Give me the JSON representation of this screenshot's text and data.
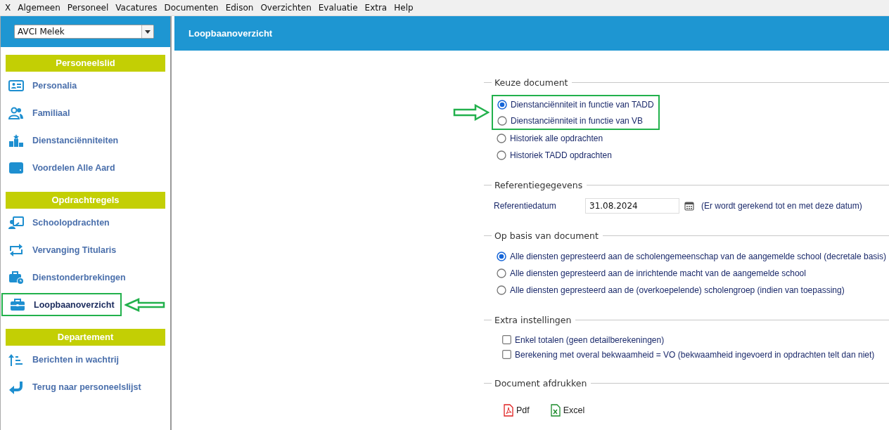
{
  "menu_bar": {
    "items": [
      "X",
      "Algemeen",
      "Personeel",
      "Vacatures",
      "Documenten",
      "Edison",
      "Overzichten",
      "Evaluatie",
      "Extra",
      "Help"
    ]
  },
  "sidebar": {
    "person_select": {
      "value": "AVCI Melek"
    },
    "groups": [
      {
        "title": "Personeelslid",
        "items": [
          {
            "label": "Personalia",
            "selected": false,
            "highlighted": false
          },
          {
            "label": "Familiaal",
            "selected": false,
            "highlighted": false
          },
          {
            "label": "Dienstanciënniteiten",
            "selected": false,
            "highlighted": false
          },
          {
            "label": "Voordelen Alle Aard",
            "selected": false,
            "highlighted": false
          }
        ]
      },
      {
        "title": "Opdrachtregels",
        "items": [
          {
            "label": "Schoolopdrachten",
            "selected": false,
            "highlighted": false
          },
          {
            "label": "Vervanging Titularis",
            "selected": false,
            "highlighted": false
          },
          {
            "label": "Dienstonderbrekingen",
            "selected": false,
            "highlighted": false
          },
          {
            "label": "Loopbaanoverzicht",
            "selected": true,
            "highlighted": true
          }
        ]
      },
      {
        "title": "Departement",
        "items": [
          {
            "label": "Berichten in wachtrij",
            "selected": false,
            "highlighted": false
          },
          {
            "label": "Terug naar personeelslijst",
            "selected": false,
            "highlighted": false
          }
        ]
      }
    ]
  },
  "header": {
    "title": "Loopbaanoverzicht"
  },
  "sections": [
    {
      "kind": "radios",
      "title": "Keuze document",
      "options": [
        {
          "label": "Dienstanciënniteit in functie van TADD",
          "selected": true,
          "highlighted": true
        },
        {
          "label": "Dienstanciënniteit in functie van VB",
          "selected": false,
          "highlighted": true
        },
        {
          "label": "Historiek alle opdrachten",
          "selected": false,
          "highlighted": false
        },
        {
          "label": "Historiek TADD opdrachten",
          "selected": false,
          "highlighted": false
        }
      ]
    },
    {
      "kind": "date",
      "title": "Referentiegegevens",
      "label": "Referentiedatum",
      "value": "31.08.2024",
      "note": "(Er wordt gerekend tot en met deze datum)"
    },
    {
      "kind": "radios",
      "title": "Op basis van document",
      "options": [
        {
          "label": "Alle diensten gepresteerd aan de scholengemeenschap van de aangemelde school (decretale basis)",
          "selected": true,
          "highlighted": false
        },
        {
          "label": "Alle diensten gepresteerd aan de inrichtende macht van de aangemelde school",
          "selected": false,
          "highlighted": false
        },
        {
          "label": "Alle diensten gepresteerd aan de (overkoepelende) scholengroep (indien van toepassing)",
          "selected": false,
          "highlighted": false
        }
      ]
    },
    {
      "kind": "checks",
      "title": "Extra instellingen",
      "options": [
        {
          "label": "Enkel totalen (geen detailberekeningen)",
          "checked": false
        },
        {
          "label": "Berekening met overal bekwaamheid = VO (bekwaamheid ingevoerd in opdrachten telt dan niet)",
          "checked": false
        }
      ]
    },
    {
      "kind": "exports",
      "title": "Document afdrukken",
      "buttons": [
        {
          "label": "Pdf",
          "kind": "pdf"
        },
        {
          "label": "Excel",
          "kind": "excel"
        }
      ]
    }
  ]
}
